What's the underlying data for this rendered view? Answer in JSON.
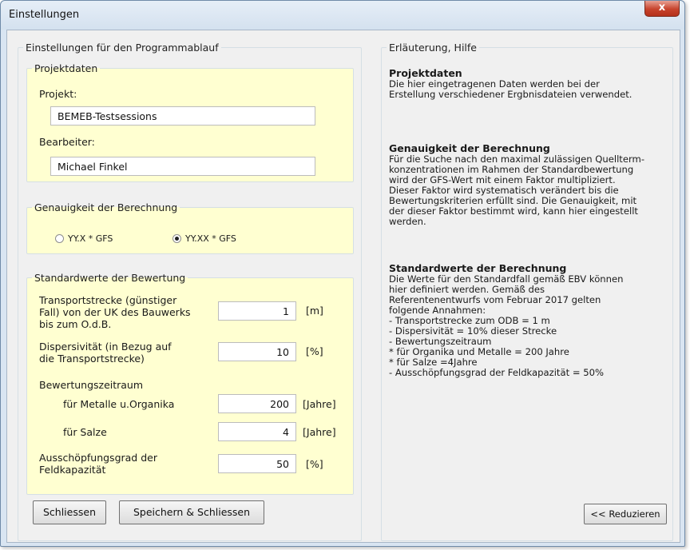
{
  "window": {
    "title": "Einstellungen",
    "close_label": "x"
  },
  "settings": {
    "legend": "Einstellungen für den Programmablauf",
    "projektdaten": {
      "legend": "Projektdaten",
      "projekt_label": "Projekt:",
      "projekt_value": "BEMEB-Testsessions",
      "bearbeiter_label": "Bearbeiter:",
      "bearbeiter_value": "Michael Finkel"
    },
    "genauigkeit": {
      "legend": "Genauigkeit der Berechnung",
      "option1": "YY.X * GFS",
      "option2": "YY.XX * GFS",
      "selected": "YY.XX * GFS"
    },
    "standardwerte": {
      "legend": "Standardwerte der Bewertung",
      "transport_label": "Transportstrecke (günstiger\nFall) von der UK des Bauwerks\nbis zum O.d.B.",
      "transport_value": "1",
      "transport_unit": "[m]",
      "dispersivitaet_label": "Dispersivität (in Bezug auf\ndie Transportstrecke)",
      "dispersivitaet_value": "10",
      "dispersivitaet_unit": "[%]",
      "zeitraum_label": "Bewertungszeitraum",
      "metalle_label": "für Metalle u.Organika",
      "metalle_value": "200",
      "metalle_unit": "[Jahre]",
      "salze_label": "für Salze",
      "salze_value": "4",
      "salze_unit": "[Jahre]",
      "ausschoepfung_label": "Ausschöpfungsgrad der\nFeldkapazität",
      "ausschoepfung_value": "50",
      "ausschoepfung_unit": "[%]"
    },
    "buttons": {
      "close": "Schliessen",
      "save_close": "Speichern & Schliessen"
    }
  },
  "help": {
    "legend": "Erläuterung, Hilfe",
    "sections": [
      {
        "title": "Projektdaten",
        "text": "Die hier eingetragenen Daten werden bei der\nErstellung verschiedener Ergbnisdateien verwendet."
      },
      {
        "title": "Genauigkeit der Berechnung",
        "text": "Für die Suche nach den maximal zulässigen Quellterm-\nkonzentrationen im Rahmen der Standardbewertung\nwird der GFS-Wert mit einem Faktor multipliziert.\nDieser Faktor wird systematisch verändert bis die\nBewertungskriterien erfüllt sind. Die Genauigkeit, mit\nder dieser Faktor bestimmt wird, kann hier eingestellt\nwerden."
      },
      {
        "title": "Standardwerte der Berechnung",
        "text": "Die Werte für den Standardfall gemäß EBV können\nhier definiert werden. Gemäß des\nReferentenentwurfs vom Februar 2017 gelten\nfolgende Annahmen:\n - Transportstrecke zum ODB = 1 m\n - Dispersivität = 10% dieser Strecke\n - Bewertungszeitraum\n      * für Organika und Metalle = 200 Jahre\n      * für Salze =4Jahre\n - Ausschöpfungsgrad der Feldkapazität = 50%"
      }
    ],
    "reduce_button": "<< Reduzieren"
  }
}
